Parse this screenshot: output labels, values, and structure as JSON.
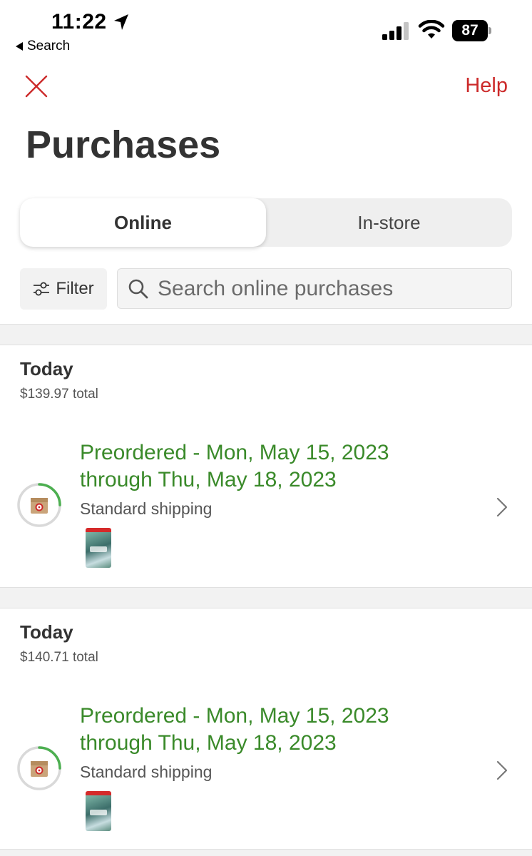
{
  "status_bar": {
    "time": "11:22",
    "back_app_label": "Search",
    "battery_level": "87"
  },
  "header": {
    "help_label": "Help",
    "title": "Purchases"
  },
  "tabs": [
    {
      "label": "Online",
      "active": true
    },
    {
      "label": "In-store",
      "active": false
    }
  ],
  "toolbar": {
    "filter_label": "Filter",
    "search_placeholder": "Search online purchases"
  },
  "orders": [
    {
      "date": "Today",
      "total": "$139.97 total",
      "status_line1": "Preordered - Mon, May 15, 2023",
      "status_line2": "through Thu, May 18, 2023",
      "shipping": "Standard shipping",
      "progress": 0.25
    },
    {
      "date": "Today",
      "total": "$140.71 total",
      "status_line1": "Preordered - Mon, May 15, 2023",
      "status_line2": "through Thu, May 18, 2023",
      "shipping": "Standard shipping",
      "progress": 0.25
    }
  ],
  "colors": {
    "accent_red": "#cc2a2a",
    "status_green": "#3a8a2a",
    "progress_green": "#4caf50"
  }
}
